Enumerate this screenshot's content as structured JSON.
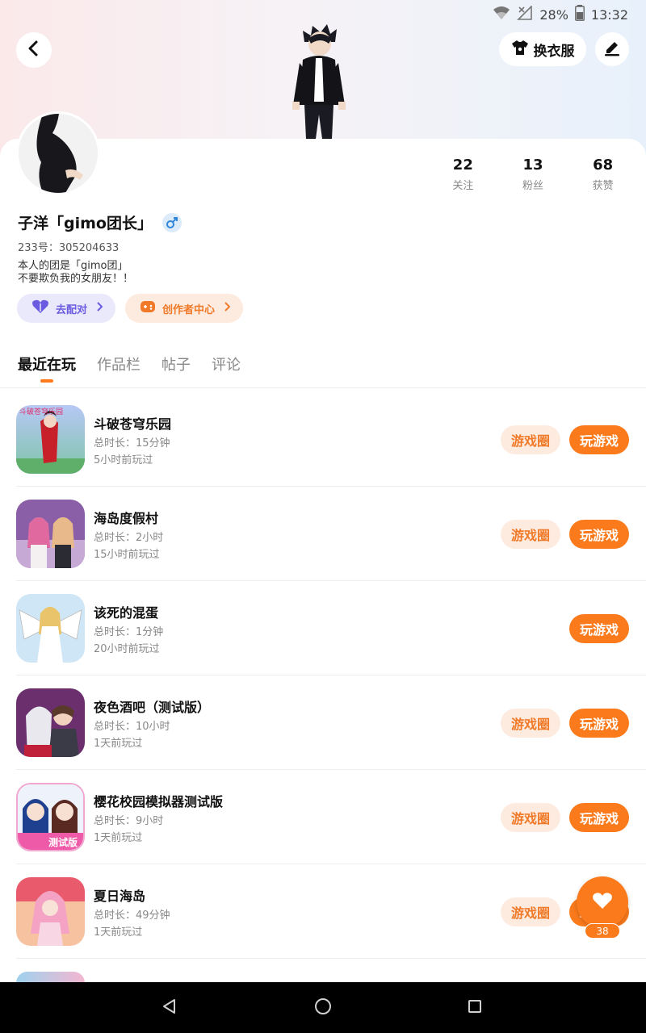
{
  "status_bar": {
    "battery": "28%",
    "time": "13:32"
  },
  "header": {
    "dress_label": "换衣服"
  },
  "profile": {
    "username": "子洋「gimo团长」",
    "uid": "233号：305204633",
    "bio_lines": [
      "本人的团是「gimo团」",
      "不要欺负我的女朋友！！"
    ],
    "stats": [
      {
        "value": "22",
        "label": "关注"
      },
      {
        "value": "13",
        "label": "粉丝"
      },
      {
        "value": "68",
        "label": "获赞"
      }
    ],
    "match_label": "去配对",
    "creator_label": "创作者中心"
  },
  "tabs": [
    {
      "label": "最近在玩"
    },
    {
      "label": "作品栏"
    },
    {
      "label": "帖子"
    },
    {
      "label": "评论"
    }
  ],
  "games": [
    {
      "name": "斗破苍穹乐园",
      "time": "总时长：15分钟",
      "last": "5小时前玩过",
      "circle": "游戏圈",
      "play": "玩游戏"
    },
    {
      "name": "海岛度假村",
      "time": "总时长：2小时",
      "last": "15小时前玩过",
      "circle": "游戏圈",
      "play": "玩游戏"
    },
    {
      "name": "该死的混蛋",
      "time": "总时长：1分钟",
      "last": "20小时前玩过",
      "circle": "",
      "play": "玩游戏"
    },
    {
      "name": "夜色酒吧（测试版）",
      "time": "总时长：10小时",
      "last": "1天前玩过",
      "circle": "游戏圈",
      "play": "玩游戏"
    },
    {
      "name": "樱花校园模拟器测试版",
      "time": "总时长：9小时",
      "last": "1天前玩过",
      "circle": "游戏圈",
      "play": "玩游戏"
    },
    {
      "name": "夏日海岛",
      "time": "总时长：49分钟",
      "last": "1天前玩过",
      "circle": "游戏圈",
      "play": "玩游戏"
    }
  ],
  "game_icon_texts": {
    "0": "斗破苍穹乐园",
    "4": "测试版"
  },
  "fab": {
    "count": "38"
  },
  "colors": {
    "accent": "#fa7a1c",
    "accent_soft": "#fdebe0",
    "match": "#6b5be0"
  }
}
